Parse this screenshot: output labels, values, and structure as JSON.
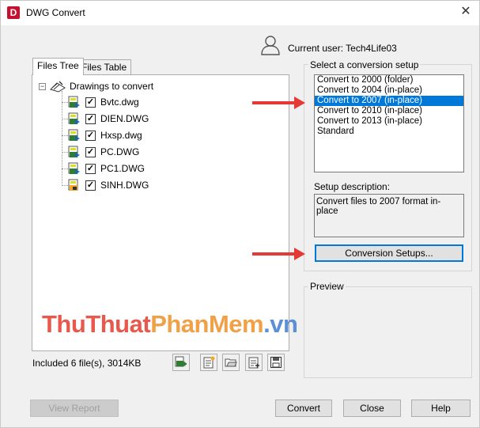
{
  "window": {
    "title": "DWG Convert",
    "close_glyph": "✕",
    "app_icon_letter": "D"
  },
  "user": {
    "label": "Current user: Tech4Life03"
  },
  "tabs": [
    {
      "label": "Files Tree"
    },
    {
      "label": "Files Table"
    }
  ],
  "tree": {
    "root_label": "Drawings to convert",
    "expander_glyph": "−",
    "files": [
      {
        "name": "Bvtc.dwg",
        "checked": true
      },
      {
        "name": "DIEN.DWG",
        "checked": true
      },
      {
        "name": "Hxsp.dwg",
        "checked": true
      },
      {
        "name": "PC.DWG",
        "checked": true
      },
      {
        "name": "PC1.DWG",
        "checked": true
      },
      {
        "name": "SINH.DWG",
        "checked": true
      }
    ],
    "check_glyph": "✓"
  },
  "status": {
    "text": "Included 6 file(s), 3014KB"
  },
  "toolbar_icons": [
    "add-file-icon",
    "new-list-icon",
    "open-list-icon",
    "append-list-icon",
    "save-list-icon"
  ],
  "setup": {
    "label": "Select a conversion setup",
    "options": [
      "Convert to 2000 (folder)",
      "Convert to 2004 (in-place)",
      "Convert to 2007 (in-place)",
      "Convert to 2010 (in-place)",
      "Convert to 2013 (in-place)",
      "Standard"
    ],
    "selected_index": 2
  },
  "description": {
    "label": "Setup description:",
    "text": "Convert files to 2007 format in-place"
  },
  "buttons": {
    "conversion_setups": "Conversion Setups...",
    "view_report": "View Report",
    "convert": "Convert",
    "close": "Close",
    "help": "Help"
  },
  "preview": {
    "label": "Preview"
  },
  "watermark": {
    "part1": "ThuThuat",
    "part2": "PhanMem",
    "part3": ".vn"
  },
  "colors": {
    "selection": "#0078d7",
    "arrow": "#e53935",
    "app_icon": "#c8102e"
  }
}
